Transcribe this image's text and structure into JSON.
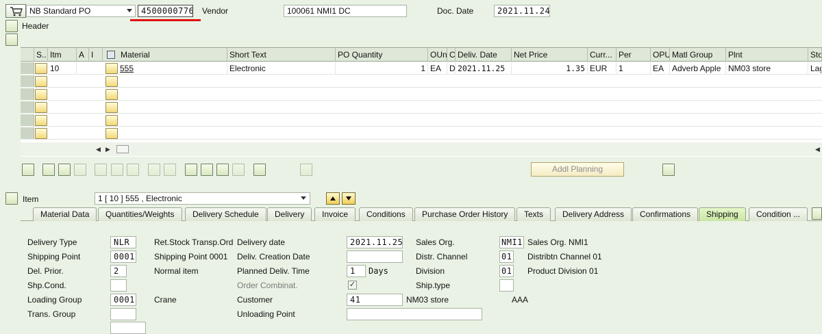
{
  "header": {
    "po_type": "NB Standard PO",
    "po_number": "4500000776",
    "vendor_label": "Vendor",
    "vendor_value": "100061 NMI1 DC",
    "doc_date_label": "Doc. Date",
    "doc_date_value": "2021.11.24",
    "header_label": "Header"
  },
  "grid": {
    "columns": [
      "S..",
      "Itm",
      "A",
      "I",
      "Material",
      "Short Text",
      "PO Quantity",
      "OUn",
      "C",
      "Deliv. Date",
      "Net Price",
      "Curr...",
      "Per",
      "OPU",
      "Matl Group",
      "Plnt",
      "Sto"
    ],
    "row1": {
      "itm": "10",
      "material": "555",
      "short_text": "Electronic",
      "po_quantity": "1",
      "oun": "EA",
      "c": "D",
      "deliv_date": "2021.11.25",
      "net_price": "1.35",
      "curr": "EUR",
      "per": "1",
      "opu": "EA",
      "matl_group": "Adverb Apple",
      "plnt": "NM03 store",
      "sto": "Lag"
    }
  },
  "toolbar": {
    "addl_planning": "Addl Planning"
  },
  "item": {
    "label": "Item",
    "selected": "1 [ 10 ] 555 , Electronic"
  },
  "tabs": [
    "Material Data",
    "Quantities/Weights",
    "Delivery Schedule",
    "Delivery",
    "Invoice",
    "Conditions",
    "Purchase Order History",
    "Texts",
    "Delivery Address",
    "Confirmations",
    "Shipping",
    "Condition ..."
  ],
  "shipping": {
    "delivery_type_label": "Delivery Type",
    "delivery_type_value": "NLR",
    "delivery_type_desc": "Ret.Stock Transp.Ord",
    "shipping_point_label": "Shipping Point",
    "shipping_point_value": "0001",
    "shipping_point_desc": "Shipping Point 0001",
    "del_prior_label": "Del. Prior.",
    "del_prior_value": "2",
    "del_prior_desc": "Normal item",
    "shp_cond_label": "Shp.Cond.",
    "loading_group_label": "Loading Group",
    "loading_group_value": "0001",
    "loading_group_desc": "Crane",
    "trans_group_label": "Trans. Group",
    "delivery_date_label": "Delivery date",
    "delivery_date_value": "2021.11.25",
    "deliv_creation_label": "Deliv. Creation Date",
    "planned_deliv_label": "Planned Deliv. Time",
    "planned_deliv_value": "1",
    "planned_deliv_unit": "Days",
    "order_combinat_label": "Order Combinat.",
    "customer_label": "Customer",
    "customer_value": "41",
    "customer_desc": "NM03 store",
    "customer_extra": "AAA",
    "unloading_point_label": "Unloading Point",
    "sales_org_label": "Sales Org.",
    "sales_org_value": "NMI1",
    "sales_org_desc": "Sales Org. NMI1",
    "distr_channel_label": "Distr. Channel",
    "distr_channel_value": "01",
    "distr_channel_desc": "Distribtn Channel 01",
    "division_label": "Division",
    "division_value": "01",
    "division_desc": "Product Division 01",
    "ship_type_label": "Ship.type"
  },
  "colors": {
    "background": "#e9f2e4",
    "highlight_underline": "#e01010",
    "active_tab": "#c8e6a4"
  }
}
